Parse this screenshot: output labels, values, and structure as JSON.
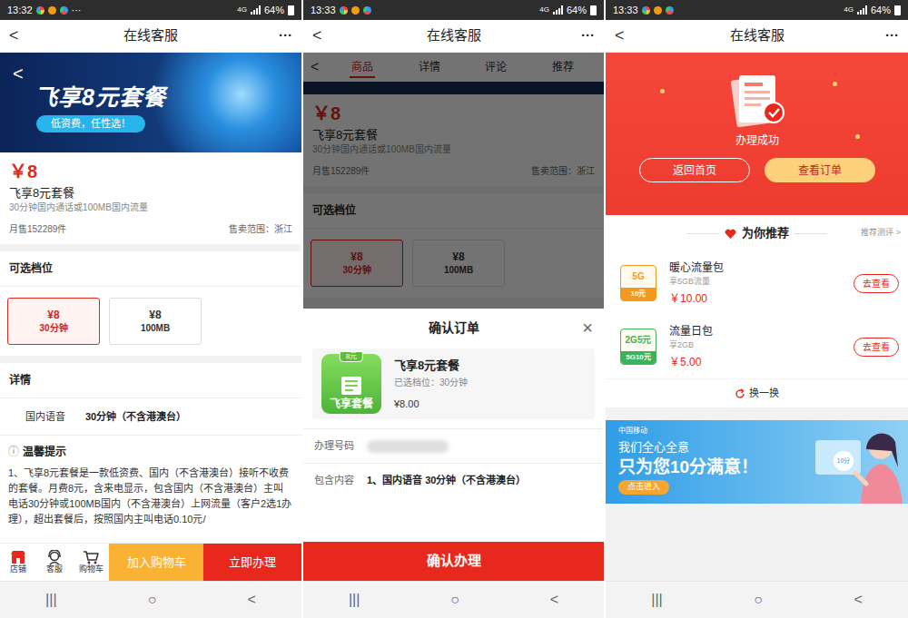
{
  "screens": [
    {
      "kind": "product",
      "status_bar": {
        "time": "13:32",
        "more": "···",
        "network": "4G",
        "battery": "64%"
      },
      "header": {
        "back": "<",
        "title": "在线客服",
        "more": "···"
      },
      "banner": {
        "back": "<",
        "title": "飞享8元套餐",
        "slogan": "低资费，任性选！"
      },
      "product": {
        "price": "￥8",
        "name": "飞享8元套餐",
        "desc": "30分钟国内通话或100MB国内流量",
        "sales": "月售152289件",
        "region": "售卖范围：浙江"
      },
      "options": {
        "label": "可选档位",
        "items": [
          {
            "price": "¥8",
            "spec": "30分钟",
            "selected": true
          },
          {
            "price": "¥8",
            "spec": "100MB",
            "selected": false
          }
        ]
      },
      "details": {
        "label": "详情",
        "rows": [
          {
            "key": "国内语音",
            "value": "30分钟（不含港澳台）"
          }
        ]
      },
      "tips": {
        "icon": "ⓘ",
        "title": "温馨提示",
        "text": "1、飞享8元套餐是一款低资费、国内（不含港澳台）接听不收费的套餐。月费8元，含来电显示，包含国内（不含港澳台）主叫电话30分钟或100MB国内（不含港澳台）上网流量（客户2选1办理），超出套餐后，按照国内主叫电话0.10元/"
      },
      "action_bar": {
        "icons": [
          "店铺",
          "客服",
          "购物车"
        ],
        "cart": "加入购物车",
        "buy": "立即办理"
      },
      "system_nav": [
        "|||",
        "○",
        "<"
      ]
    },
    {
      "kind": "confirm",
      "status_bar": {
        "time": "13:33",
        "network": "4G",
        "battery": "64%"
      },
      "header": {
        "back": "<",
        "title": "在线客服",
        "more": "···"
      },
      "tabs": {
        "back": "<",
        "items": [
          {
            "label": "商品",
            "selected": true
          },
          {
            "label": "详情",
            "selected": false
          },
          {
            "label": "评论",
            "selected": false
          },
          {
            "label": "推荐",
            "selected": false
          }
        ]
      },
      "background": {
        "product": {
          "price": "￥8",
          "name": "飞享8元套餐",
          "desc": "30分钟国内通话或100MB国内流量",
          "sales": "月售152289件",
          "region": "售卖范围：浙江"
        },
        "options": {
          "label": "可选档位",
          "items": [
            {
              "price": "¥8",
              "spec": "30分钟",
              "selected": true
            },
            {
              "price": "¥8",
              "spec": "100MB",
              "selected": false
            }
          ]
        }
      },
      "sheet": {
        "title": "确认订单",
        "close": "×",
        "product": {
          "badge": "8元",
          "icon_label": "飞享套餐",
          "name": "飞享8元套餐",
          "option": "已选档位：30分钟",
          "price": "¥8.00"
        },
        "fields": [
          {
            "key": "办理号码",
            "blurred": true
          },
          {
            "key": "包含内容",
            "value": "1、国内语音 30分钟（不含港澳台）",
            "blurred": false
          }
        ],
        "confirm": "确认办理"
      },
      "system_nav": [
        "|||",
        "○",
        "<"
      ]
    },
    {
      "kind": "success",
      "status_bar": {
        "time": "13:33",
        "network": "4G",
        "battery": "64%"
      },
      "header": {
        "back": "<",
        "title": "在线客服",
        "more": "···"
      },
      "success": {
        "title": "办理成功",
        "home": "返回首页",
        "orders": "查看订单"
      },
      "recommend": {
        "title": "为你推荐",
        "link": "推荐测评 >",
        "items": [
          {
            "icon_top": "5G",
            "icon_bottom": "10元",
            "name": "暖心流量包",
            "desc": "享5GB流量",
            "price": "￥10.00",
            "action": "去查看",
            "color": "#f39a1e"
          },
          {
            "icon_top": "2G5元",
            "icon_bottom": "5G10元",
            "name": "流量日包",
            "desc": "享2GB",
            "price": "￥5.00",
            "action": "去查看",
            "color": "#3cb35a"
          }
        ],
        "refresh": "换一换"
      },
      "ad": {
        "brand": "中国移动",
        "line1": "我们全心全意",
        "line2": "只为您10分满意！",
        "button": "点击进入",
        "badge": "10分"
      },
      "system_nav": [
        "|||",
        "○",
        "<"
      ]
    }
  ]
}
